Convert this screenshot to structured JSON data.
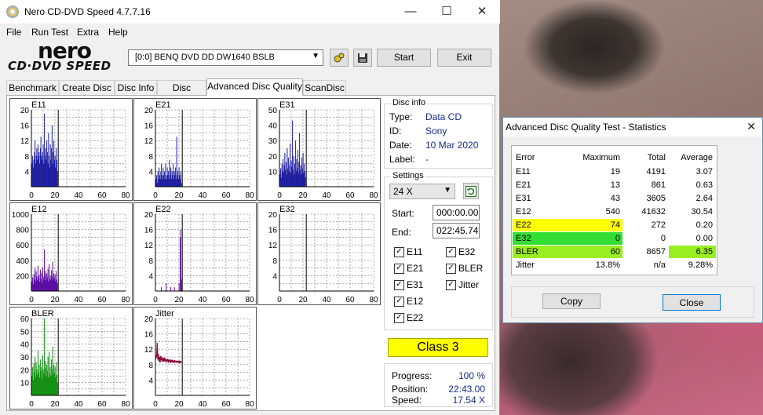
{
  "window": {
    "title": "Nero CD-DVD Speed 4.7.7.16",
    "min": "—",
    "max": "☐",
    "close": "✕"
  },
  "menu": [
    "File",
    "Run Test",
    "Extra",
    "Help"
  ],
  "logo": {
    "line1": "nero",
    "line2": "CD·DVD SPEED"
  },
  "drive": {
    "selected": "[0:0]   BENQ DVD DD DW1640 BSLB"
  },
  "toolbar": {
    "start_label": "Start",
    "exit_label": "Exit"
  },
  "tabs": [
    "Benchmark",
    "Create Disc",
    "Disc Info",
    "Disc Quality",
    "Advanced Disc Quality",
    "ScanDisc"
  ],
  "active_tab": 4,
  "chart_data": [
    {
      "type": "bar",
      "name": "E11",
      "xlim": [
        0,
        80
      ],
      "ylim": [
        0,
        20
      ],
      "yticks": [
        4,
        8,
        12,
        16,
        20
      ],
      "xticks": [
        0,
        20,
        40,
        60,
        80
      ],
      "color": "#1c1ca0",
      "disc_end": 22.8,
      "x": [
        0.5,
        1,
        1.5,
        2,
        2.5,
        3,
        3.5,
        4,
        4.5,
        5,
        5.5,
        6,
        6.5,
        7,
        7.5,
        8,
        8.5,
        9,
        9.5,
        10,
        10.5,
        11,
        11.5,
        12,
        12.5,
        13,
        13.5,
        14,
        14.5,
        15,
        15.5,
        16,
        16.5,
        17,
        17.5,
        18,
        18.5,
        19,
        19.5,
        20,
        20.5,
        21,
        21.5,
        22
      ],
      "values": [
        6,
        8,
        5,
        7,
        9,
        12,
        6,
        8,
        10,
        7,
        11,
        8,
        9,
        6,
        10,
        13,
        8,
        7,
        9,
        11,
        6,
        19,
        8,
        10,
        7,
        12,
        9,
        6,
        14,
        8,
        5,
        11,
        7,
        10,
        16,
        6,
        9,
        12,
        7,
        8,
        5,
        10,
        7,
        4
      ]
    },
    {
      "type": "bar",
      "name": "E21",
      "xlim": [
        0,
        80
      ],
      "ylim": [
        0,
        20
      ],
      "yticks": [
        4,
        8,
        12,
        16,
        20
      ],
      "xticks": [
        0,
        20,
        40,
        60,
        80
      ],
      "color": "#1c1ca0",
      "disc_end": 22.8,
      "x": [
        0.5,
        1,
        1.5,
        2,
        2.5,
        3,
        3.5,
        4,
        4.5,
        5,
        5.5,
        6,
        6.5,
        7,
        7.5,
        8,
        8.5,
        9,
        9.5,
        10,
        10.5,
        11,
        11.5,
        12,
        12.5,
        13,
        13.5,
        14,
        14.5,
        15,
        15.5,
        16,
        16.5,
        17,
        17.5,
        18,
        18.5,
        19,
        19.5,
        20,
        20.5,
        21,
        21.5,
        22
      ],
      "values": [
        2,
        3,
        1,
        4,
        2,
        5,
        3,
        2,
        4,
        6,
        3,
        2,
        5,
        3,
        4,
        2,
        6,
        3,
        2,
        5,
        3,
        4,
        2,
        7,
        3,
        5,
        2,
        4,
        3,
        6,
        2,
        4,
        3,
        5,
        2,
        13,
        3,
        4,
        2,
        5,
        3,
        2,
        4,
        1
      ]
    },
    {
      "type": "bar",
      "name": "E31",
      "xlim": [
        0,
        80
      ],
      "ylim": [
        0,
        50
      ],
      "yticks": [
        10,
        20,
        30,
        40,
        50
      ],
      "xticks": [
        0,
        20,
        40,
        60,
        80
      ],
      "color": "#1c1ca0",
      "disc_end": 22.8,
      "x": [
        0.5,
        1,
        1.5,
        2,
        2.5,
        3,
        3.5,
        4,
        4.5,
        5,
        5.5,
        6,
        6.5,
        7,
        7.5,
        8,
        8.5,
        9,
        9.5,
        10,
        10.5,
        11,
        11.5,
        12,
        12.5,
        13,
        13.5,
        14,
        14.5,
        15,
        15.5,
        16,
        16.5,
        17,
        17.5,
        18,
        18.5,
        19,
        19.5,
        20,
        20.5,
        21,
        21.5,
        22
      ],
      "values": [
        8,
        12,
        6,
        15,
        10,
        18,
        9,
        14,
        22,
        11,
        16,
        8,
        25,
        12,
        19,
        10,
        14,
        28,
        9,
        17,
        13,
        43,
        11,
        20,
        8,
        15,
        30,
        10,
        18,
        12,
        24,
        9,
        16,
        35,
        11,
        14,
        8,
        19,
        12,
        22,
        9,
        15,
        10,
        6
      ]
    },
    {
      "type": "area",
      "name": "E12",
      "xlim": [
        0,
        80
      ],
      "ylim": [
        0,
        1000
      ],
      "yticks": [
        200,
        400,
        600,
        800,
        1000
      ],
      "xticks": [
        0,
        20,
        40,
        60,
        80
      ],
      "color": "#5a0aa0",
      "disc_end": 22.8,
      "x": [
        0.5,
        1,
        1.5,
        2,
        2.5,
        3,
        3.5,
        4,
        4.5,
        5,
        5.5,
        6,
        6.5,
        7,
        7.5,
        8,
        8.5,
        9,
        9.5,
        10,
        10.5,
        11,
        11.5,
        12,
        12.5,
        13,
        13.5,
        14,
        14.5,
        15,
        15.5,
        16,
        16.5,
        17,
        17.5,
        18,
        18.5,
        19,
        19.5,
        20,
        20.5,
        21,
        21.5,
        22
      ],
      "values": [
        120,
        180,
        90,
        220,
        150,
        300,
        130,
        260,
        190,
        140,
        330,
        170,
        210,
        120,
        280,
        160,
        240,
        110,
        310,
        190,
        150,
        540,
        200,
        260,
        140,
        230,
        180,
        290,
        120,
        350,
        160,
        200,
        140,
        270,
        190,
        380,
        150,
        230,
        170,
        210,
        130,
        260,
        150,
        100
      ]
    },
    {
      "type": "bar",
      "name": "E22",
      "xlim": [
        0,
        80
      ],
      "ylim": [
        0,
        20
      ],
      "yticks": [
        4,
        8,
        12,
        16,
        20
      ],
      "xticks": [
        0,
        20,
        40,
        60,
        80
      ],
      "color": "#5a0aa0",
      "disc_end": 22.8,
      "x": [
        5,
        9,
        13,
        16,
        20,
        21,
        21.5,
        22
      ],
      "values": [
        1,
        2,
        1,
        1,
        2,
        14,
        16,
        3
      ]
    },
    {
      "type": "bar",
      "name": "E32",
      "xlim": [
        0,
        80
      ],
      "ylim": [
        0,
        20
      ],
      "yticks": [
        4,
        8,
        12,
        16,
        20
      ],
      "xticks": [
        0,
        20,
        40,
        60,
        80
      ],
      "color": "#5a0aa0",
      "disc_end": 22.8,
      "x": [],
      "values": []
    },
    {
      "type": "bar",
      "name": "BLER",
      "xlim": [
        0,
        80
      ],
      "ylim": [
        0,
        60
      ],
      "yticks": [
        10,
        20,
        30,
        40,
        50,
        60
      ],
      "xticks": [
        0,
        20,
        40,
        60,
        80
      ],
      "color": "#119011",
      "disc_end": 22.8,
      "x": [
        0.5,
        1,
        1.5,
        2,
        2.5,
        3,
        3.5,
        4,
        4.5,
        5,
        5.5,
        6,
        6.5,
        7,
        7.5,
        8,
        8.5,
        9,
        9.5,
        10,
        10.5,
        11,
        11.5,
        12,
        12.5,
        13,
        13.5,
        14,
        14.5,
        15,
        15.5,
        16,
        16.5,
        17,
        17.5,
        18,
        18.5,
        19,
        19.5,
        20,
        20.5,
        21,
        21.5,
        22
      ],
      "values": [
        15,
        22,
        12,
        25,
        18,
        30,
        14,
        26,
        20,
        16,
        35,
        18,
        24,
        14,
        28,
        19,
        22,
        13,
        31,
        20,
        17,
        60,
        21,
        27,
        15,
        24,
        19,
        30,
        14,
        34,
        17,
        22,
        15,
        28,
        20,
        38,
        16,
        24,
        18,
        22,
        14,
        26,
        16,
        10
      ]
    },
    {
      "type": "line",
      "name": "Jitter",
      "xlim": [
        0,
        80
      ],
      "ylim": [
        0,
        20
      ],
      "yticks": [
        4,
        8,
        12,
        16,
        20
      ],
      "xticks": [
        0,
        20,
        40,
        60,
        80
      ],
      "color": "#8a0a3a",
      "disc_end": 22.8,
      "x": [
        0.5,
        1,
        1.5,
        2,
        2.5,
        3,
        3.5,
        4,
        4.5,
        5,
        5.5,
        6,
        6.5,
        7,
        7.5,
        8,
        8.5,
        9,
        9.5,
        10,
        10.5,
        11,
        11.5,
        12,
        12.5,
        13,
        13.5,
        14,
        14.5,
        15,
        15.5,
        16,
        16.5,
        17,
        17.5,
        18,
        18.5,
        19,
        19.5,
        20,
        20.5,
        21,
        21.5,
        22
      ],
      "values": [
        9.8,
        10.2,
        13.5,
        9.5,
        10.6,
        9.0,
        9.9,
        8.7,
        10.1,
        9.3,
        9.7,
        9.0,
        9.5,
        8.9,
        9.6,
        9.1,
        9.4,
        8.8,
        9.2,
        9.0,
        9.3,
        8.7,
        9.1,
        8.9,
        9.2,
        8.6,
        9.0,
        8.8,
        9.1,
        8.7,
        8.9,
        8.6,
        9.0,
        8.8,
        8.7,
        8.9,
        8.6,
        8.8,
        8.7,
        8.9,
        8.5,
        8.8,
        8.6,
        8.7
      ]
    }
  ],
  "disc_info": {
    "title": "Disc info",
    "rows": [
      {
        "label": "Type:",
        "value": "Data CD"
      },
      {
        "label": "ID:",
        "value": "Sony"
      },
      {
        "label": "Date:",
        "value": "10 Mar 2020"
      },
      {
        "label": "Label:",
        "value": "-"
      }
    ]
  },
  "settings": {
    "title": "Settings",
    "speed": "24 X",
    "start_label": "Start:",
    "start_value": "000:00.00",
    "end_label": "End:",
    "end_value": "022:45.74",
    "checks_left": [
      "E11",
      "E21",
      "E31",
      "E12",
      "E22"
    ],
    "checks_right": [
      "E32",
      "BLER",
      "Jitter"
    ]
  },
  "class_label": "Class 3",
  "status": {
    "progress_label": "Progress:",
    "progress_value": "100 %",
    "position_label": "Position:",
    "position_value": "22:43.00",
    "speed_label": "Speed:",
    "speed_value": "17.54 X"
  },
  "dialog": {
    "title": "Advanced Disc Quality Test - Statistics",
    "headers": [
      "Error",
      "Maximum",
      "Total",
      "Average"
    ],
    "rows": [
      {
        "name": "E11",
        "max": "19",
        "total": "4191",
        "avg": "3.07",
        "highlight": ""
      },
      {
        "name": "E21",
        "max": "13",
        "total": "861",
        "avg": "0.63",
        "highlight": ""
      },
      {
        "name": "E31",
        "max": "43",
        "total": "3605",
        "avg": "2.64",
        "highlight": ""
      },
      {
        "name": "E12",
        "max": "540",
        "total": "41632",
        "avg": "30.54",
        "highlight": ""
      },
      {
        "name": "E22",
        "max": "74",
        "total": "272",
        "avg": "0.20",
        "highlight": "#ffff00"
      },
      {
        "name": "E32",
        "max": "0",
        "total": "0",
        "avg": "0.00",
        "highlight": "#33dd33"
      },
      {
        "name": "BLER",
        "max": "60",
        "total": "8657",
        "avg": "6.35",
        "highlight": "#99ee22"
      },
      {
        "name": "Jitter",
        "max": "13.8%",
        "total": "n/a",
        "avg": "9.28%",
        "highlight": ""
      }
    ],
    "copy_label": "Copy",
    "close_label": "Close"
  }
}
